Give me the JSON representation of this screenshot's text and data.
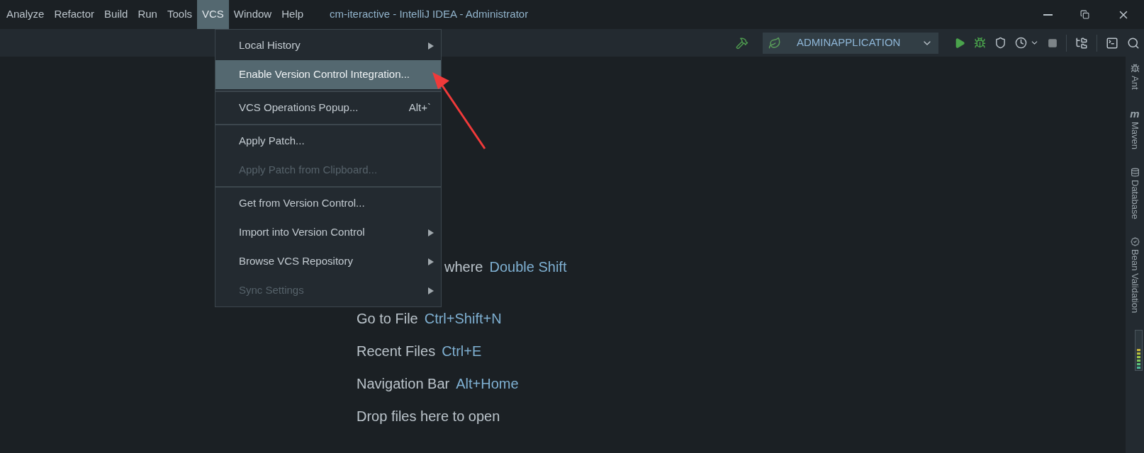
{
  "menu_bar": [
    {
      "label": "Analyze",
      "selected": false
    },
    {
      "label": "Refactor",
      "selected": false
    },
    {
      "label": "Build",
      "selected": false
    },
    {
      "label": "Run",
      "selected": false
    },
    {
      "label": "Tools",
      "selected": false
    },
    {
      "label": "VCS",
      "selected": true
    },
    {
      "label": "Window",
      "selected": false
    },
    {
      "label": "Help",
      "selected": false
    }
  ],
  "window": {
    "title": "cm-iteractive - IntelliJ IDEA - Administrator"
  },
  "toolbar": {
    "run_configuration": "ADMINAPPLICATION"
  },
  "vcs_menu": [
    {
      "kind": "item",
      "label": "Local History",
      "submenu": true,
      "disabled": false,
      "selected": false
    },
    {
      "kind": "item",
      "label": "Enable Version Control Integration...",
      "submenu": false,
      "disabled": false,
      "selected": true
    },
    {
      "kind": "separator"
    },
    {
      "kind": "item",
      "label": "VCS Operations Popup...",
      "shortcut": "Alt+`",
      "submenu": false,
      "disabled": false,
      "selected": false
    },
    {
      "kind": "separator"
    },
    {
      "kind": "item",
      "label": "Apply Patch...",
      "submenu": false,
      "disabled": false,
      "selected": false
    },
    {
      "kind": "item",
      "label": "Apply Patch from Clipboard...",
      "submenu": false,
      "disabled": true,
      "selected": false
    },
    {
      "kind": "separator"
    },
    {
      "kind": "item",
      "label": "Get from Version Control...",
      "submenu": false,
      "disabled": false,
      "selected": false
    },
    {
      "kind": "item",
      "label": "Import into Version Control",
      "submenu": true,
      "disabled": false,
      "selected": false
    },
    {
      "kind": "item",
      "label": "Browse VCS Repository",
      "submenu": true,
      "disabled": false,
      "selected": false
    },
    {
      "kind": "item",
      "label": "Sync Settings",
      "submenu": true,
      "disabled": true,
      "selected": false
    }
  ],
  "hints": [
    {
      "label": "where",
      "shortcut": "Double Shift"
    },
    {
      "label": "Go to File",
      "shortcut": "Ctrl+Shift+N"
    },
    {
      "label": "Recent Files",
      "shortcut": "Ctrl+E"
    },
    {
      "label": "Navigation Bar",
      "shortcut": "Alt+Home"
    },
    {
      "label": "Drop files here to open"
    }
  ],
  "right_sidebar": [
    {
      "kind": "ant",
      "label": "Ant"
    },
    {
      "kind": "maven",
      "icon": "m",
      "label": "Maven"
    },
    {
      "kind": "database",
      "label": "Database"
    },
    {
      "kind": "bean",
      "label": "Bean Validation"
    }
  ]
}
